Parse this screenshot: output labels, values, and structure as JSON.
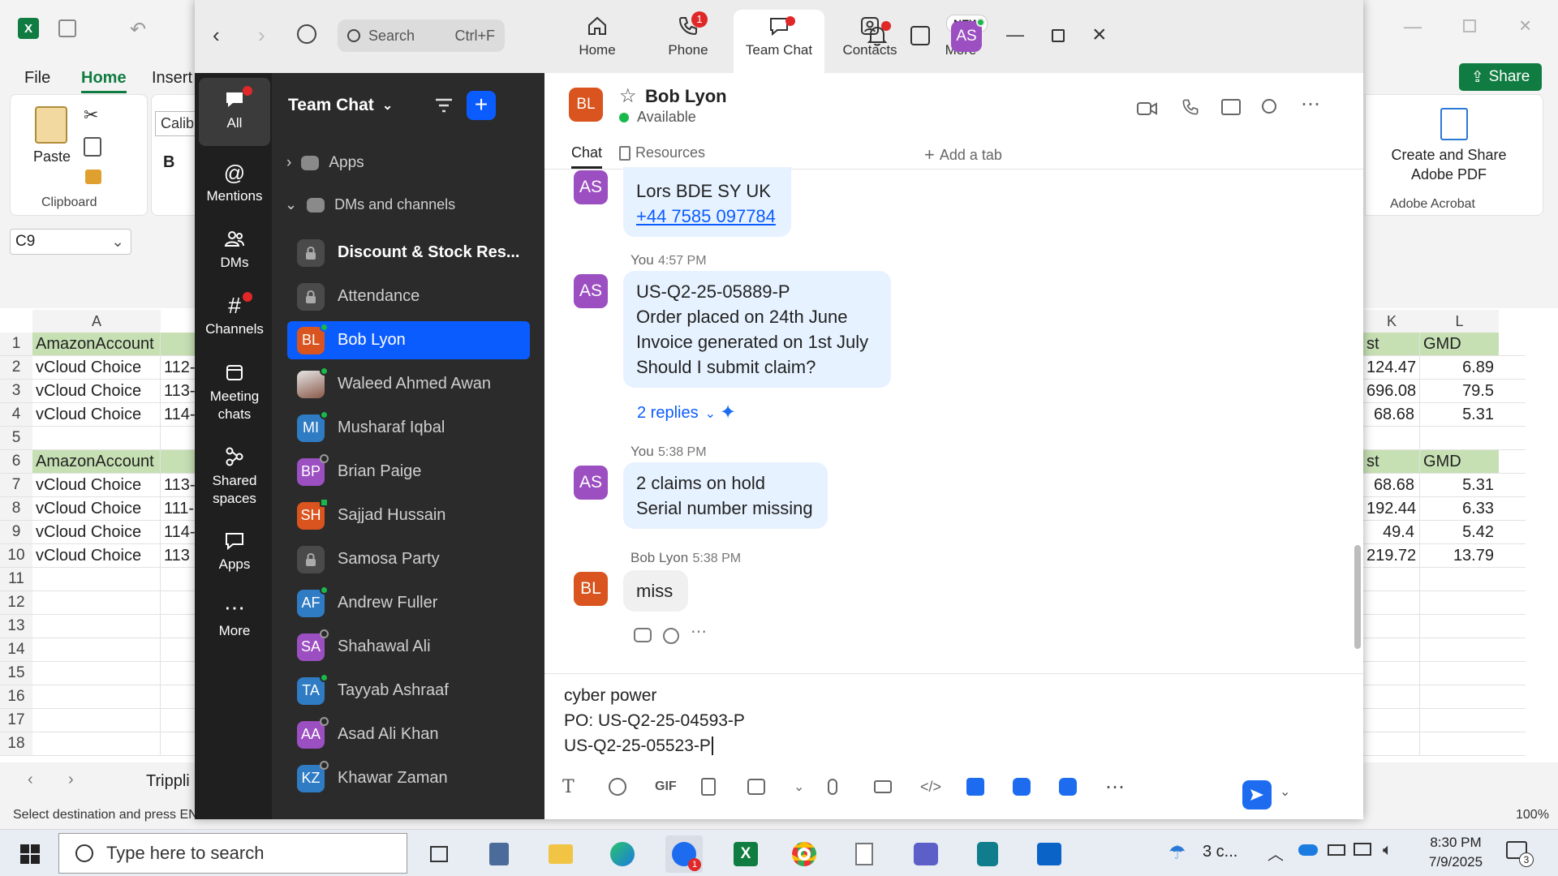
{
  "excel": {
    "menu": {
      "file": "File",
      "home": "Home",
      "insert": "Insert"
    },
    "clipboard": {
      "paste": "Paste",
      "group": "Clipboard"
    },
    "font_box": "Calibri",
    "bold": "B",
    "name_box": "C9",
    "share": "Share",
    "adobe": {
      "label": "Create and Share Adobe PDF",
      "group": "Adobe Acrobat"
    },
    "columns_left": [
      "A"
    ],
    "columns_right": [
      "K",
      "L"
    ],
    "rows": [
      {
        "n": "1",
        "a": "AmazonAccount",
        "b": "",
        "k": "st",
        "l": "GMD",
        "hdr": true
      },
      {
        "n": "2",
        "a": "vCloud Choice",
        "b": "112-",
        "k": "124.47",
        "l": "6.89"
      },
      {
        "n": "3",
        "a": "vCloud Choice",
        "b": "113-",
        "k": "696.08",
        "l": "79.5"
      },
      {
        "n": "4",
        "a": "vCloud Choice",
        "b": "114-",
        "k": "68.68",
        "l": "5.31"
      },
      {
        "n": "5",
        "a": "",
        "b": "",
        "k": "",
        "l": ""
      },
      {
        "n": "6",
        "a": "AmazonAccount",
        "b": "",
        "k": "st",
        "l": "GMD",
        "hdr": true
      },
      {
        "n": "7",
        "a": "vCloud Choice",
        "b": "113-",
        "k": "68.68",
        "l": "5.31"
      },
      {
        "n": "8",
        "a": "vCloud Choice",
        "b": "111-",
        "k": "192.44",
        "l": "6.33"
      },
      {
        "n": "9",
        "a": "vCloud Choice",
        "b": "114-",
        "k": "49.4",
        "l": "5.42"
      },
      {
        "n": "10",
        "a": "vCloud Choice",
        "b": "113",
        "k": "219.72",
        "l": "13.79"
      },
      {
        "n": "11",
        "a": "",
        "b": "",
        "k": "",
        "l": ""
      },
      {
        "n": "12",
        "a": "",
        "b": "",
        "k": "",
        "l": ""
      },
      {
        "n": "13",
        "a": "",
        "b": "",
        "k": "",
        "l": ""
      },
      {
        "n": "14",
        "a": "",
        "b": "",
        "k": "",
        "l": ""
      },
      {
        "n": "15",
        "a": "",
        "b": "",
        "k": "",
        "l": ""
      },
      {
        "n": "16",
        "a": "",
        "b": "",
        "k": "",
        "l": ""
      },
      {
        "n": "17",
        "a": "",
        "b": "",
        "k": "",
        "l": ""
      },
      {
        "n": "18",
        "a": "",
        "b": "",
        "k": "",
        "l": ""
      }
    ],
    "sheet_tab": "Trippli",
    "status": "Select destination and press ENT",
    "zoom": "100%"
  },
  "zoom": {
    "search": {
      "placeholder": "Search",
      "shortcut": "Ctrl+F"
    },
    "nav": [
      {
        "label": "Home",
        "icon": "home-icon"
      },
      {
        "label": "Phone",
        "icon": "phone-icon",
        "badge": "1"
      },
      {
        "label": "Team Chat",
        "icon": "chat-icon"
      },
      {
        "label": "Contacts",
        "icon": "contacts-icon"
      },
      {
        "label": "More",
        "icon": "more-icon",
        "badge": "NEW"
      }
    ],
    "user_initials": "AS",
    "rail": [
      {
        "label": "All"
      },
      {
        "label": "Mentions"
      },
      {
        "label": "DMs"
      },
      {
        "label": "Channels"
      },
      {
        "label": "Meeting chats"
      },
      {
        "label": "Shared spaces"
      },
      {
        "label": "Apps"
      },
      {
        "label": "More"
      }
    ],
    "list": {
      "title": "Team Chat",
      "apps": "Apps",
      "dms_header": "DMs and channels",
      "items": [
        {
          "name": "Discount & Stock Res...",
          "type": "lock",
          "bold": true
        },
        {
          "name": "Attendance",
          "type": "lock"
        },
        {
          "name": "Bob Lyon",
          "initials": "BL",
          "color": "#d9541e",
          "selected": true,
          "status": "green"
        },
        {
          "name": "Waleed Ahmed Awan",
          "initials": "",
          "color": "#b8b8b8",
          "status": "green",
          "photo": true
        },
        {
          "name": "Musharaf Iqbal",
          "initials": "MI",
          "color": "#2f7cc4",
          "status": "green"
        },
        {
          "name": "Brian Paige",
          "initials": "BP",
          "color": "#9b4fc1",
          "status": "away"
        },
        {
          "name": "Sajjad Hussain",
          "initials": "SH",
          "color": "#d9541e",
          "status": "phone"
        },
        {
          "name": "Samosa Party",
          "type": "lock"
        },
        {
          "name": "Andrew Fuller",
          "initials": "AF",
          "color": "#2f7cc4",
          "status": "green"
        },
        {
          "name": "Shahawal Ali",
          "initials": "SA",
          "color": "#9b4fc1",
          "status": "away"
        },
        {
          "name": "Tayyab Ashraaf",
          "initials": "TA",
          "color": "#2f7cc4",
          "status": "green"
        },
        {
          "name": "Asad Ali Khan",
          "initials": "AA",
          "color": "#9b4fc1",
          "status": "away"
        },
        {
          "name": "Khawar Zaman",
          "initials": "KZ",
          "color": "#2f7cc4",
          "status": "away"
        }
      ]
    },
    "chat": {
      "contact": "Bob Lyon",
      "contact_initials": "BL",
      "status": "Available",
      "tabs": {
        "chat": "Chat",
        "resources": "Resources",
        "add": "Add a tab"
      },
      "messages": [
        {
          "lines": [
            "Lors BDE SY UK"
          ],
          "link": "+44 7585 097784"
        },
        {
          "sender": "You",
          "time": "4:57 PM",
          "lines": [
            "US-Q2-25-05889-P",
            "Order placed on 24th June",
            "Invoice generated on 1st July",
            "Should I submit claim?"
          ],
          "replies": "2 replies"
        },
        {
          "sender": "You",
          "time": "5:38 PM",
          "lines": [
            "2 claims on hold",
            "Serial number missing"
          ]
        },
        {
          "sender": "Bob Lyon",
          "time": "5:38 PM",
          "lines": [
            "miss"
          ]
        }
      ],
      "composer": [
        "cyber power",
        "PO: US-Q2-25-04593-P",
        "US-Q2-25-05523-P"
      ],
      "my_initials": "AS"
    }
  },
  "taskbar": {
    "search": "Type here to search",
    "weather": "3 c...",
    "time": "8:30 PM",
    "date": "7/9/2025",
    "notif": "3"
  },
  "colors": {
    "accent": "#0b5cff",
    "excel_green": "#c6e0b4",
    "excel_brand": "#107c41",
    "bubble": "#e6f2ff"
  }
}
